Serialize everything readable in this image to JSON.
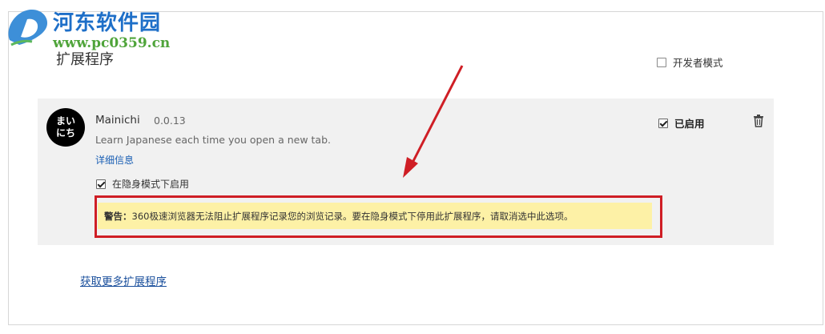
{
  "watermark": {
    "title": "河东软件园",
    "url": "www.pc0359.cn"
  },
  "page": {
    "title": "扩展程序"
  },
  "developer_mode": {
    "label": "开发者模式",
    "checked": false
  },
  "extension": {
    "icon_text": [
      "まい",
      "にち"
    ],
    "name": "Mainichi",
    "version": "0.0.13",
    "description": "Learn Japanese each time you open a new tab.",
    "details_link": "详细信息",
    "incognito_label": "在隐身模式下启用",
    "incognito_checked": true,
    "enabled_label": "已启用",
    "enabled_checked": true,
    "warning_prefix": "警告：",
    "warning_text": "360极速浏览器无法阻止扩展程序记录您的浏览记录。要在隐身模式下停用此扩展程序，请取消选中此选项。"
  },
  "more_link": "获取更多扩展程序",
  "colors": {
    "annotation": "#cf1e25",
    "warning_bg": "#fdf1a6",
    "link": "#1a4f9c",
    "card_bg": "#f1f1f1"
  }
}
